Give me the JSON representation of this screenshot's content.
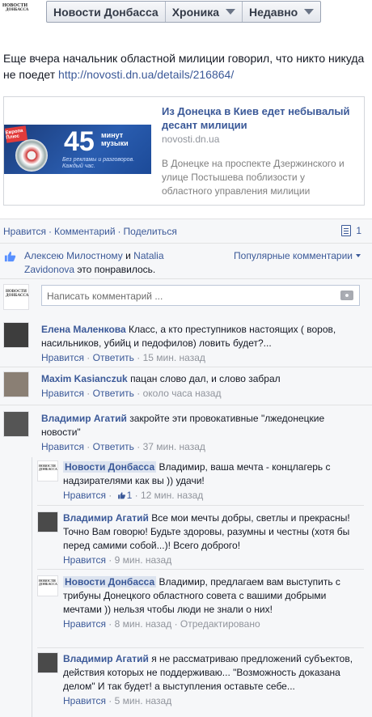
{
  "header": {
    "logo_line1": "НОВОСТИ",
    "logo_line2": "ДОНБАССА",
    "tabs": [
      {
        "label": "Новости Донбасса"
      },
      {
        "label": "Хроника"
      },
      {
        "label": "Недавно"
      }
    ]
  },
  "post": {
    "text": "Еще вчера начальник областной милиции говорил, что никто никуда не поедет",
    "url": "http://novosti.dn.ua/details/216864/"
  },
  "preview": {
    "banner_radio": "Европа Плюс",
    "banner_number": "45",
    "banner_word1": "минут",
    "banner_word2": "музыки",
    "banner_small": "Без рекламы и разговоров. Каждый час.",
    "title": "Из Донецка в Киев едет небывалый десант милиции",
    "domain": "novosti.dn.ua",
    "description": "В Донецке на проспекте Дзержинского и улице Постышева поблизости у областного управления милиции"
  },
  "actions": {
    "like": "Нравится",
    "comment": "Комментарий",
    "share": "Поделиться",
    "comment_count": "1"
  },
  "likes": {
    "person1": "Алексею Милостному",
    "and": "и",
    "person2": "Natalia Zavidonova",
    "suffix": "это понравилось.",
    "popular": "Популярные комментарии"
  },
  "composer": {
    "placeholder": "Написать комментарий ..."
  },
  "comments": [
    {
      "author": "Елена Маленкова",
      "text": "Класс, а кто преступников настоящих ( воров, насильников, убийц и педофилов) ловить будет?...",
      "like": "Нравится",
      "reply": "Ответить",
      "time": "15 мин. назад"
    },
    {
      "author": "Maxim Kasianczuk",
      "text": "пацан слово дал, и слово забрал",
      "like": "Нравится",
      "reply": "Ответить",
      "time": "около часа назад"
    },
    {
      "author": "Владимир Агатий",
      "text": "закройте эти провокативные \"лжедонецкие новости\"",
      "like": "Нравится",
      "reply": "Ответить",
      "time": "37 мин. назад"
    }
  ],
  "replies": [
    {
      "author": "Новости Донбасса",
      "text": "Владимир, ваша мечта - концлагерь с надзирателями как вы )) удачи!",
      "like": "Нравится",
      "likes_count": "1",
      "time": "12 мин. назад"
    },
    {
      "author": "Владимир Агатий",
      "text": "Все мои мечты добры, светлы и прекрасны! Точно Вам говорю! Будьте здоровы, разумны и честны (хотя бы перед самими собой...)! Всего доброго!",
      "like": "Нравится",
      "time": "9 мин. назад"
    },
    {
      "author": "Новости Донбасса",
      "text": "Владимир, предлагаем вам выступить с трибуны Донецкого областного совета с вашими добрыми мечтами )) нельзя чтобы люди не знали о них!",
      "like": "Нравится",
      "time": "8 мин. назад",
      "edited": "Отредактировано"
    },
    {
      "author": "Владимир Агатий",
      "text": "я не рассматриваю предложений субъектов, действия которых не поддерживаю... \"Возможность доказана делом\" И так будет! а выступления оставьте себе...",
      "like": "Нравится",
      "time": "5 мин. назад"
    }
  ]
}
